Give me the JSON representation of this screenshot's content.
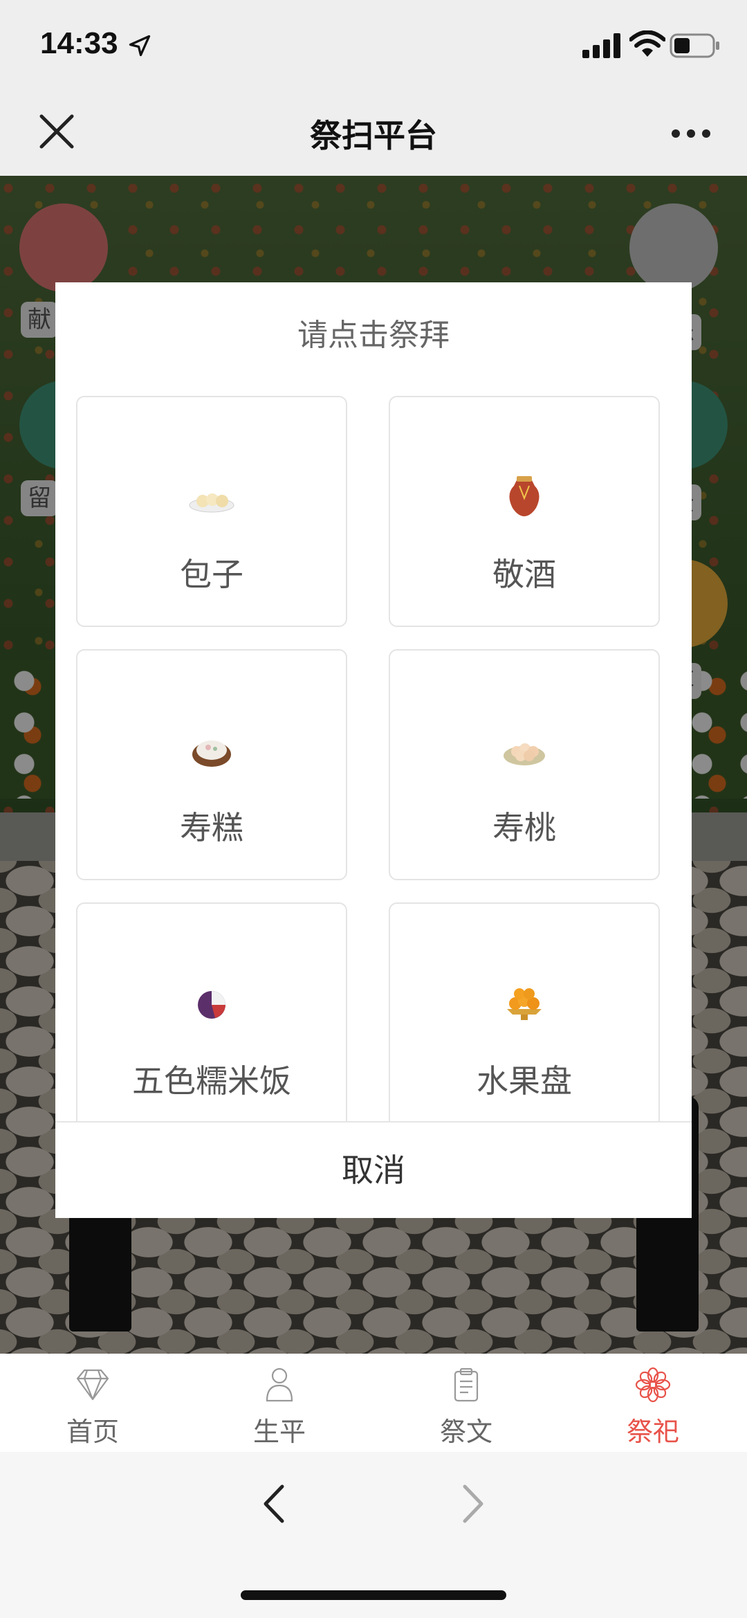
{
  "status_bar": {
    "time": "14:33"
  },
  "nav": {
    "title": "祭扫平台"
  },
  "scene": {
    "side_left": [
      "献",
      "留"
    ],
    "side_right": [
      "乐",
      "景",
      "享"
    ]
  },
  "modal": {
    "title": "请点击祭拜",
    "items": [
      {
        "label": "包子",
        "icon": "steamed-bun-icon"
      },
      {
        "label": "敬酒",
        "icon": "wine-jar-icon"
      },
      {
        "label": "寿糕",
        "icon": "longevity-cake-icon"
      },
      {
        "label": "寿桃",
        "icon": "longevity-peach-icon"
      },
      {
        "label": "五色糯米饭",
        "icon": "five-color-rice-icon"
      },
      {
        "label": "水果盘",
        "icon": "fruit-plate-icon"
      }
    ],
    "cancel": "取消"
  },
  "tabbar": {
    "items": [
      {
        "label": "首页",
        "icon": "diamond-icon"
      },
      {
        "label": "生平",
        "icon": "person-icon"
      },
      {
        "label": "祭文",
        "icon": "clipboard-icon"
      },
      {
        "label": "祭祀",
        "icon": "flower-icon"
      }
    ],
    "active_color": "#e8534a"
  }
}
